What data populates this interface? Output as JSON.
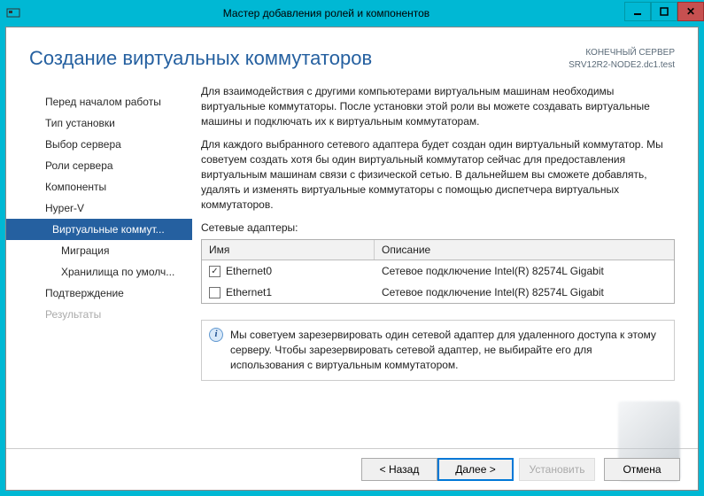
{
  "window": {
    "title": "Мастер добавления ролей и компонентов"
  },
  "header": {
    "title": "Создание виртуальных коммутаторов",
    "server_label": "КОНЕЧНЫЙ СЕРВЕР",
    "server_name": "SRV12R2-NODE2.dc1.test"
  },
  "nav": {
    "items": [
      "Перед началом работы",
      "Тип установки",
      "Выбор сервера",
      "Роли сервера",
      "Компоненты",
      "Hyper-V",
      "Виртуальные коммут...",
      "Миграция",
      "Хранилища по умолч...",
      "Подтверждение",
      "Результаты"
    ]
  },
  "content": {
    "paragraph1": "Для взаимодействия с другими компьютерами виртуальным машинам необходимы виртуальные коммутаторы. После установки этой роли вы можете создавать виртуальные машины и подключать их к виртуальным коммутаторам.",
    "paragraph2": "Для каждого выбранного сетевого адаптера будет создан один виртуальный коммутатор. Мы советуем создать хотя бы один виртуальный коммутатор сейчас для предоставления виртуальным машинам связи с физической сетью. В дальнейшем вы сможете добавлять, удалять и изменять виртуальные коммутаторы с помощью диспетчера виртуальных коммутаторов.",
    "adapters_label": "Сетевые адаптеры:",
    "columns": {
      "name": "Имя",
      "desc": "Описание"
    },
    "rows": [
      {
        "checked": true,
        "name": "Ethernet0",
        "desc": "Сетевое подключение Intel(R) 82574L Gigabit"
      },
      {
        "checked": false,
        "name": "Ethernet1",
        "desc": "Сетевое подключение Intel(R) 82574L Gigabit"
      }
    ],
    "info": "Мы советуем зарезервировать один сетевой адаптер для удаленного доступа к этому серверу. Чтобы зарезервировать сетевой адаптер, не выбирайте его для использования с виртуальным коммутатором."
  },
  "footer": {
    "back": "< Назад",
    "next": "Далее >",
    "install": "Установить",
    "cancel": "Отмена"
  }
}
